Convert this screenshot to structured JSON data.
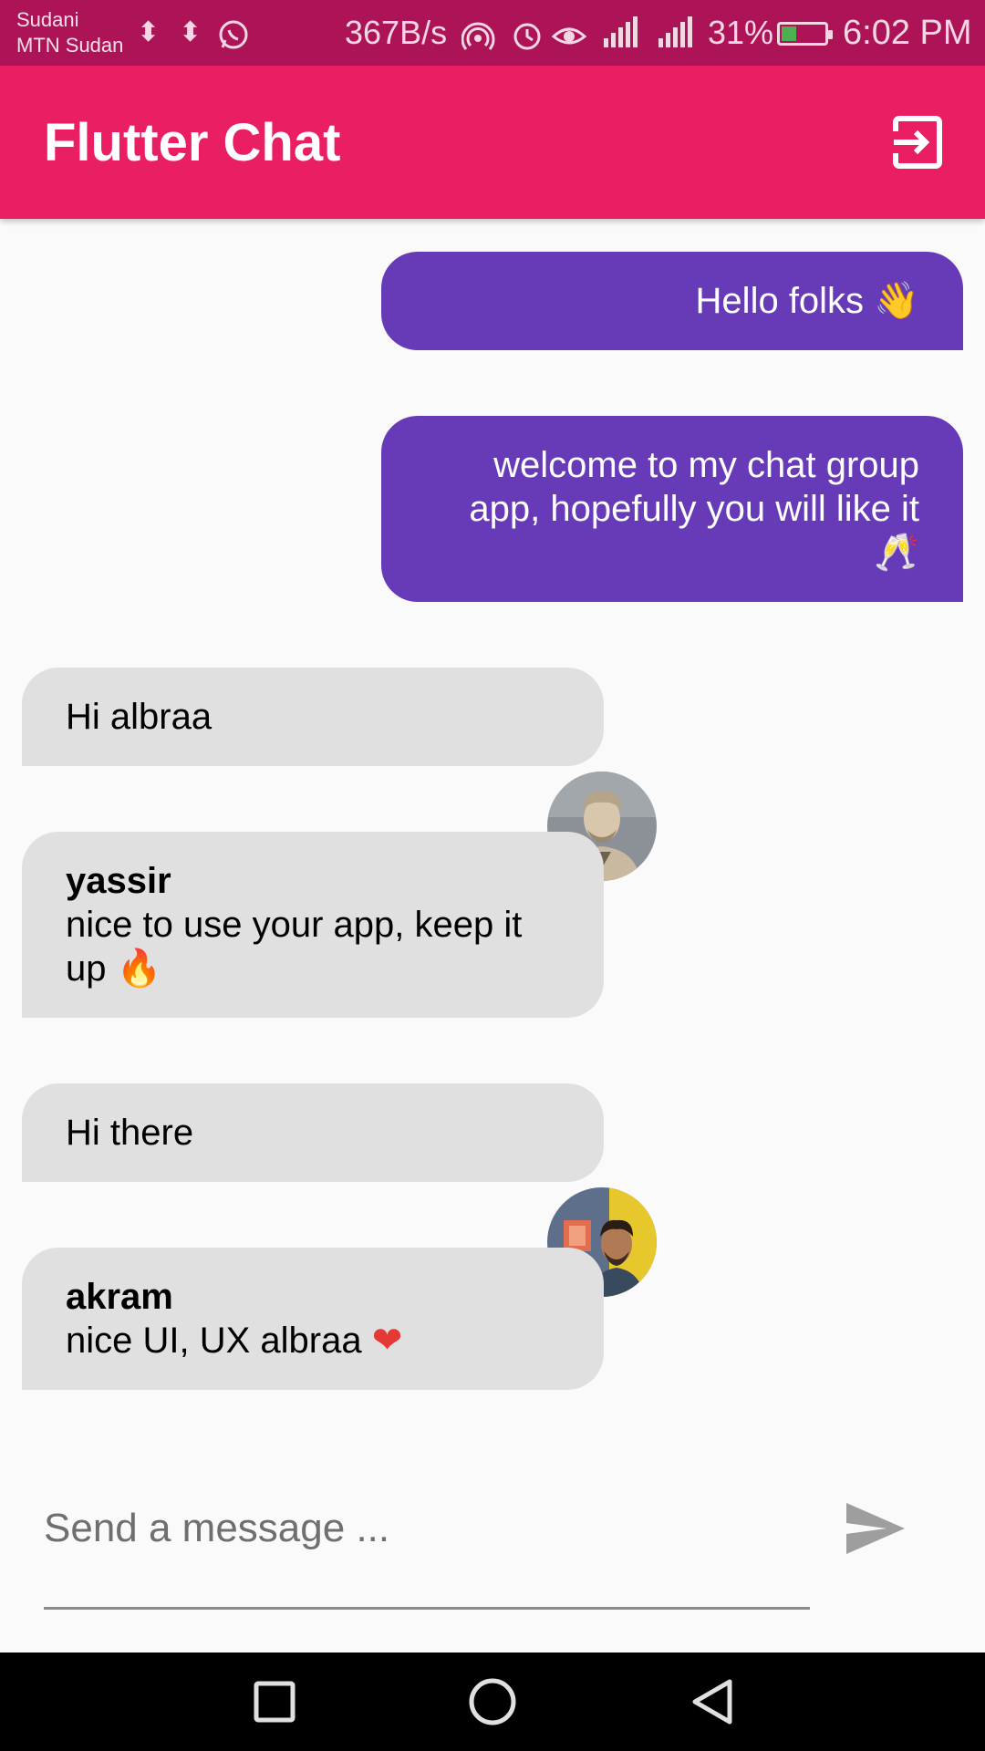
{
  "status_bar": {
    "carrier_line1": "Sudani",
    "carrier_line2": "MTN Sudan",
    "net_speed": "367B/s",
    "battery_percent": "31%",
    "time": "6:02 PM",
    "background": "#ad1457"
  },
  "app_bar": {
    "title": "Flutter Chat",
    "background": "#e91e63",
    "logout_icon": "logout-icon"
  },
  "messages": [
    {
      "mine": true,
      "text": "Hello folks",
      "emoji": "👋"
    },
    {
      "mine": true,
      "text_line1": "welcome to my chat group",
      "text_line2": "app, hopefully you will like it",
      "emoji": "🥂"
    },
    {
      "mine": false,
      "text": "Hi albraa"
    },
    {
      "mine": false,
      "username": "yassir",
      "text_line1": "nice to use your app, keep it",
      "text_line2": "up",
      "emoji": "🔥"
    },
    {
      "mine": false,
      "text": "Hi there"
    },
    {
      "mine": false,
      "username": "akram",
      "text": "nice UI, UX albraa",
      "emoji": "❤"
    }
  ],
  "composer": {
    "placeholder": "Send a message ...",
    "value": "",
    "send_icon": "send-icon"
  },
  "colors": {
    "my_bubble": "#673ab7",
    "their_bubble": "#e0e0e0"
  }
}
